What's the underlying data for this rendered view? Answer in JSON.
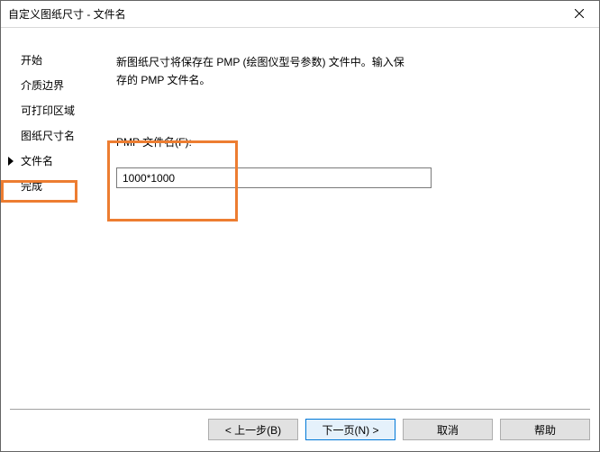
{
  "title": "自定义图纸尺寸 - 文件名",
  "sidebar": {
    "items": [
      {
        "label": "开始"
      },
      {
        "label": "介质边界"
      },
      {
        "label": "可打印区域"
      },
      {
        "label": "图纸尺寸名"
      },
      {
        "label": "文件名"
      },
      {
        "label": "完成"
      }
    ],
    "active_index": 4
  },
  "main": {
    "description": "新图纸尺寸将保存在 PMP (绘图仪型号参数) 文件中。输入保存的 PMP 文件名。",
    "field_label": "PMP 文件名(F):",
    "field_value": "1000*1000"
  },
  "buttons": {
    "back": "< 上一步(B)",
    "next": "下一页(N) >",
    "cancel": "取消",
    "help": "帮助"
  }
}
